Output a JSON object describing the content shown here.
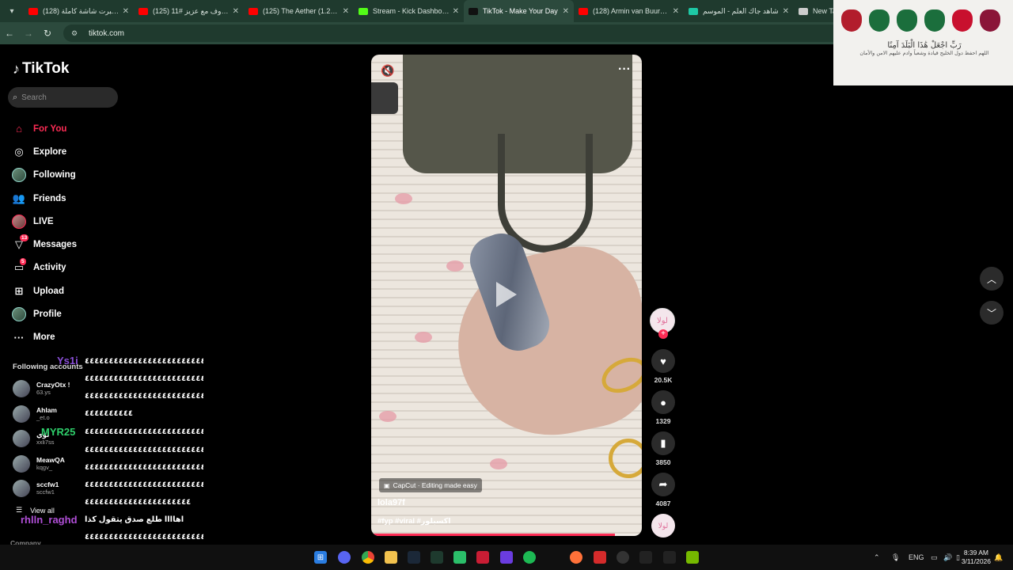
{
  "browser": {
    "tabs": [
      {
        "title": "(128) البرت شاشة كاملة ()",
        "color": "#ff0000",
        "active": false
      },
      {
        "title": "(125) حروف مع عزيز #11",
        "color": "#ff0000",
        "active": false
      },
      {
        "title": "(125) The Aether (1.20.1)",
        "color": "#ff0000",
        "active": false
      },
      {
        "title": "Stream - Kick Dashboard",
        "color": "#53fc18",
        "active": false
      },
      {
        "title": "TikTok - Make Your Day",
        "color": "#111111",
        "active": true
      },
      {
        "title": "(128) Armin van Buuren -",
        "color": "#ff0000",
        "active": false
      },
      {
        "title": "شاهد جاك العلم - الموسم",
        "color": "#1ec8a5",
        "active": false
      },
      {
        "title": "New Tab",
        "color": "#cccccc",
        "active": false
      }
    ],
    "url": "tiktok.com"
  },
  "sidebar": {
    "logo": "TikTok",
    "search_placeholder": "Search",
    "nav": [
      {
        "label": "For You",
        "icon": "home-icon",
        "glyph": "⌂",
        "active": true
      },
      {
        "label": "Explore",
        "icon": "compass-icon",
        "glyph": "◎",
        "active": false
      },
      {
        "label": "Following",
        "icon": "following-avatar-icon",
        "glyph": "",
        "active": false
      },
      {
        "label": "Friends",
        "icon": "friends-icon",
        "glyph": "👥",
        "active": false
      },
      {
        "label": "LIVE",
        "icon": "live-avatar-icon",
        "glyph": "",
        "active": false
      },
      {
        "label": "Messages",
        "icon": "messages-icon",
        "glyph": "▽",
        "active": false,
        "badge": "13"
      },
      {
        "label": "Activity",
        "icon": "activity-icon",
        "glyph": "▭",
        "active": false,
        "badge": "5"
      },
      {
        "label": "Upload",
        "icon": "upload-icon",
        "glyph": "⊞",
        "active": false
      },
      {
        "label": "Profile",
        "icon": "profile-avatar-icon",
        "glyph": "",
        "active": false
      },
      {
        "label": "More",
        "icon": "more-icon",
        "glyph": "···",
        "active": false
      }
    ],
    "following_title": "Following accounts",
    "accounts": [
      {
        "name": "CrazyOtx !",
        "handle": "63.ys"
      },
      {
        "name": "Ahlam",
        "handle": "_et.o"
      },
      {
        "name": "لؤي",
        "handle": "xxli7ss"
      },
      {
        "name": "MeawQA",
        "handle": "kqgv_"
      },
      {
        "name": "sccfw1",
        "handle": "sccfw1"
      }
    ],
    "view_all": "View all",
    "company": "Company"
  },
  "chat": {
    "lines": [
      "٤٤٤٤٤٤٤٤٤٤٤٤٤٤٤٤٤٤٤٤٤٤٤٤٤٤",
      "٤٤٤٤٤٤٤٤٤٤٤٤٤٤٤٤٤٤٤٤٤٤٤٤٤٤",
      "٤٤٤٤٤٤٤٤٤٤٤٤٤٤٤٤٤٤٤٤٤٤٤٤٤٤",
      "٤٤٤٤٤٤٤٤٤٤",
      "٤٤٤٤٤٤٤٤٤٤٤٤٤٤٤٤٤٤٤٤٤٤٤٤٤٤",
      "٤٤٤٤٤٤٤٤٤٤٤٤٤٤٤٤٤٤٤٤٤٤٤٤٤٤",
      "٤٤٤٤٤٤٤٤٤٤٤٤٤٤٤٤٤٤٤٤٤٤٤٤٤٤",
      "٤٤٤٤٤٤٤٤٤٤٤٤٤٤٤٤٤٤٤٤٤٤٤٤٤٤",
      "٤٤٤٤٤٤٤٤٤٤٤٤٤٤٤٤٤٤٤٤٤٤",
      "اهاااا طلع صدق يتقول كذا",
      "٤٤٤٤٤٤٤٤٤٤٤٤٤٤٤٤٤٤٤٤٤٤٤٤٤٤",
      "٤٤٤٤"
    ],
    "users": [
      {
        "name": "Ys1i",
        "color": "#8a4fd8"
      },
      {
        "name": "MYR25",
        "color": "#2fcf6b"
      },
      {
        "name": "rhlln_raghd",
        "color": "#b14fd8"
      }
    ]
  },
  "video": {
    "capcut": "CapCut · Editing made easy",
    "author": "lola97f",
    "tags": "#fyp #viral #اكسبلور",
    "progress": 0.9
  },
  "actions": {
    "avatar_text": "لولا",
    "likes": "20.5K",
    "comments": "1329",
    "saves": "3850",
    "shares": "4087"
  },
  "overlay": {
    "title": "رَبِّ اجْعَلْ هَٰذَا الْبَلَدَ آمِنًا",
    "subtitle": "اللهم احفظ دول الخليج قيادة وشعباً وادم عليهم الامن والأمان",
    "flag_colors": [
      "#b21d2c",
      "#1b6e3c",
      "#1b6e3c",
      "#1b6e3c",
      "#c8102e",
      "#8a1538"
    ]
  },
  "taskbar": {
    "language": "ENG",
    "time": "8:39 AM",
    "date": "3/11/2026"
  }
}
